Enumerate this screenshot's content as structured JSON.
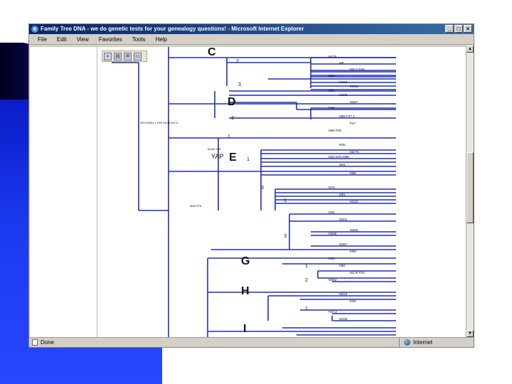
{
  "window": {
    "title": "Family Tree DNA - we do genetic tests for your genealogy questions! - Microsoft Internet Explorer",
    "menu": [
      "File",
      "Edit",
      "View",
      "Favorites",
      "Tools",
      "Help"
    ],
    "status_left": "Done",
    "status_zone": "Internet"
  },
  "tree": {
    "big_labels": [
      "C",
      "D",
      "E",
      "G",
      "H",
      "I"
    ],
    "ymp_label": "YAP",
    "side_markers": [
      "SRY10831.1 YAP M145 M174",
      "M168 YAP",
      "M89 PF5"
    ],
    "row_labels": [
      "M130",
      "M8",
      "M217 P44",
      "M38",
      "M210",
      "M356",
      "M93",
      "M208",
      "M347",
      "M15",
      "M55 P37.1",
      "P47",
      "M96 P29",
      "M35",
      "M2 P1",
      "M33 M75 M98",
      "M41",
      "M60",
      "M78",
      "M81",
      "M123",
      "M34",
      "M201",
      "M285",
      "M286",
      "M287",
      "M69",
      "M52",
      "M82",
      "M170 P19",
      "M253",
      "M223",
      "M26",
      "P37.2",
      "M438"
    ]
  },
  "colors": {
    "tree_line": "#1f2fb0",
    "title_bar": "#0a246a",
    "slide_blue": "#1b3af0"
  }
}
